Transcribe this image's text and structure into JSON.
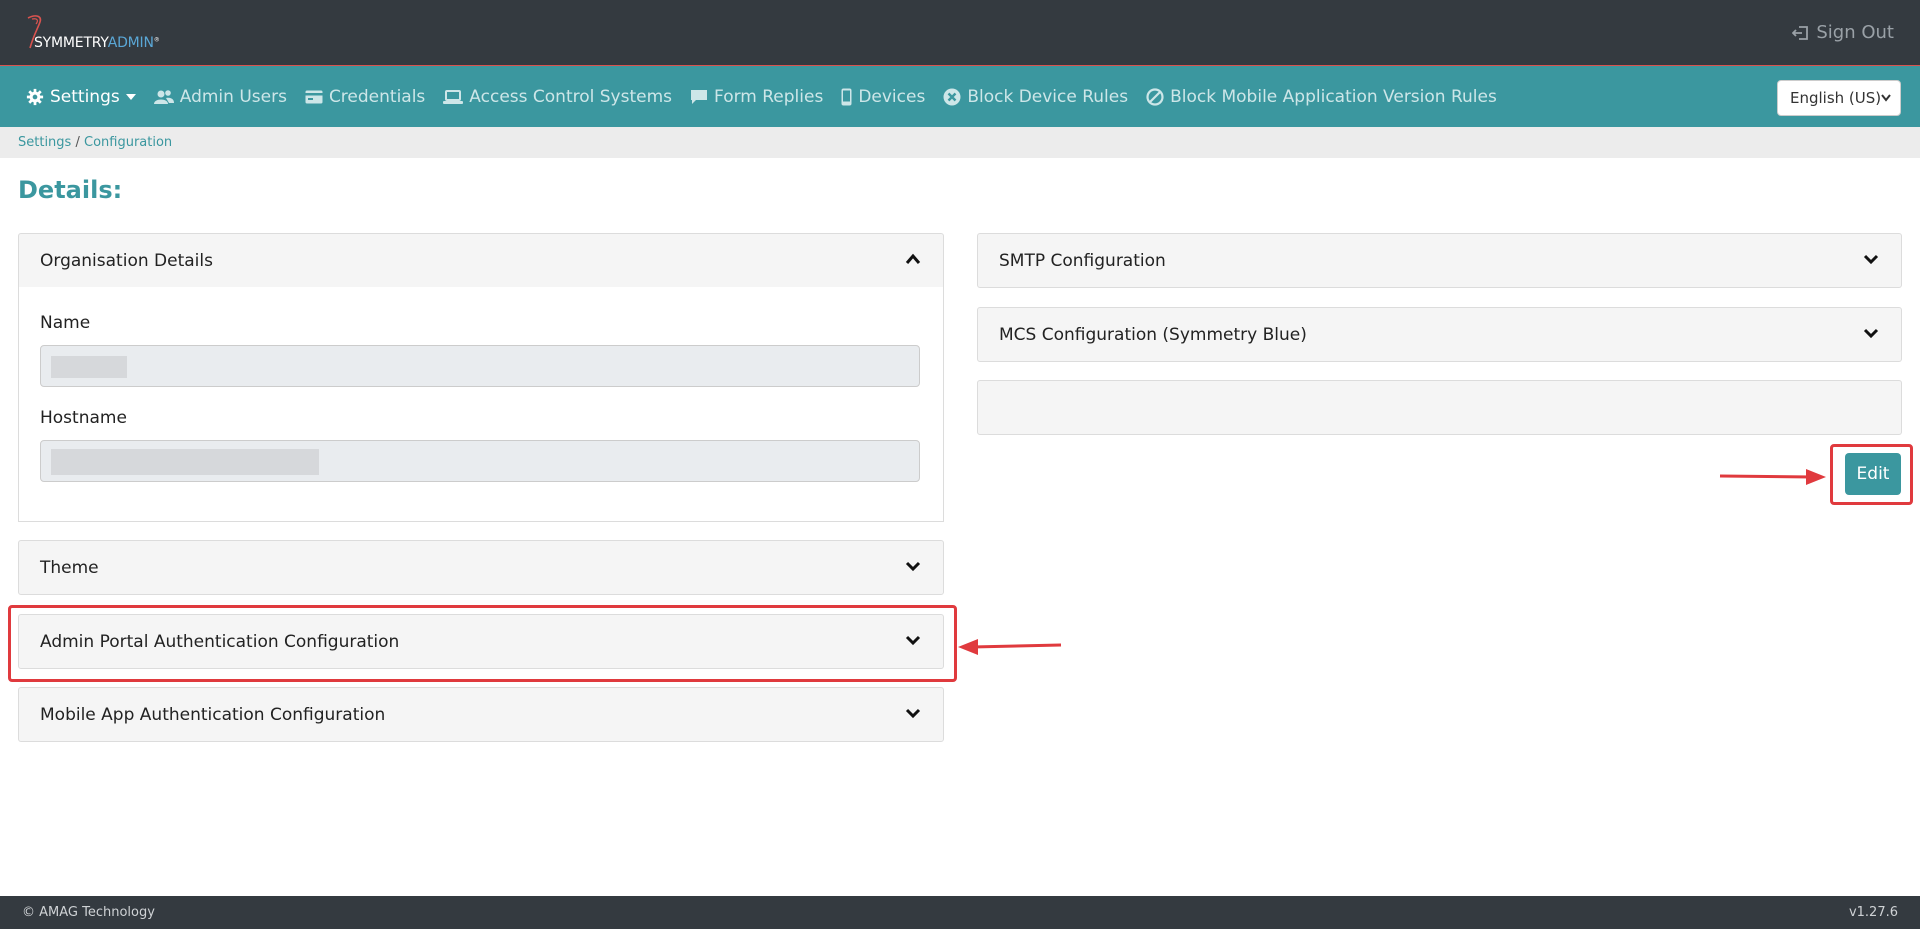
{
  "header": {
    "logo_text_1": "SYMMETRY",
    "logo_text_2": "ADMIN",
    "logo_mark": "®",
    "signout_label": "Sign Out"
  },
  "nav": {
    "items": [
      {
        "label": "Settings",
        "icon": "gear-icon",
        "active": true
      },
      {
        "label": "Admin Users",
        "icon": "users-icon"
      },
      {
        "label": "Credentials",
        "icon": "card-icon"
      },
      {
        "label": "Access Control Systems",
        "icon": "laptop-icon"
      },
      {
        "label": "Form Replies",
        "icon": "comment-icon"
      },
      {
        "label": "Devices",
        "icon": "mobile-icon"
      },
      {
        "label": "Block Device Rules",
        "icon": "times-circle-icon"
      },
      {
        "label": "Block Mobile Application Version Rules",
        "icon": "ban-icon"
      }
    ],
    "language": "English (US)"
  },
  "breadcrumb": {
    "root": "Settings",
    "separator": "/",
    "current": "Configuration"
  },
  "page": {
    "title": "Details:"
  },
  "left_panels": {
    "org": {
      "title": "Organisation Details",
      "name_label": "Name",
      "hostname_label": "Hostname"
    },
    "theme": "Theme",
    "admin_auth": "Admin Portal Authentication Configuration",
    "mobile_auth": "Mobile App Authentication Configuration"
  },
  "right_panels": {
    "smtp": "SMTP Configuration",
    "mcs": "MCS Configuration (Symmetry Blue)",
    "blank": ""
  },
  "actions": {
    "edit": "Edit"
  },
  "footer": {
    "copyright": "© AMAG Technology",
    "version": "v1.27.6"
  },
  "colors": {
    "topbar": "#343a40",
    "nav": "#3b979f",
    "accent": "#3b979f",
    "highlight": "#e03a3e"
  }
}
